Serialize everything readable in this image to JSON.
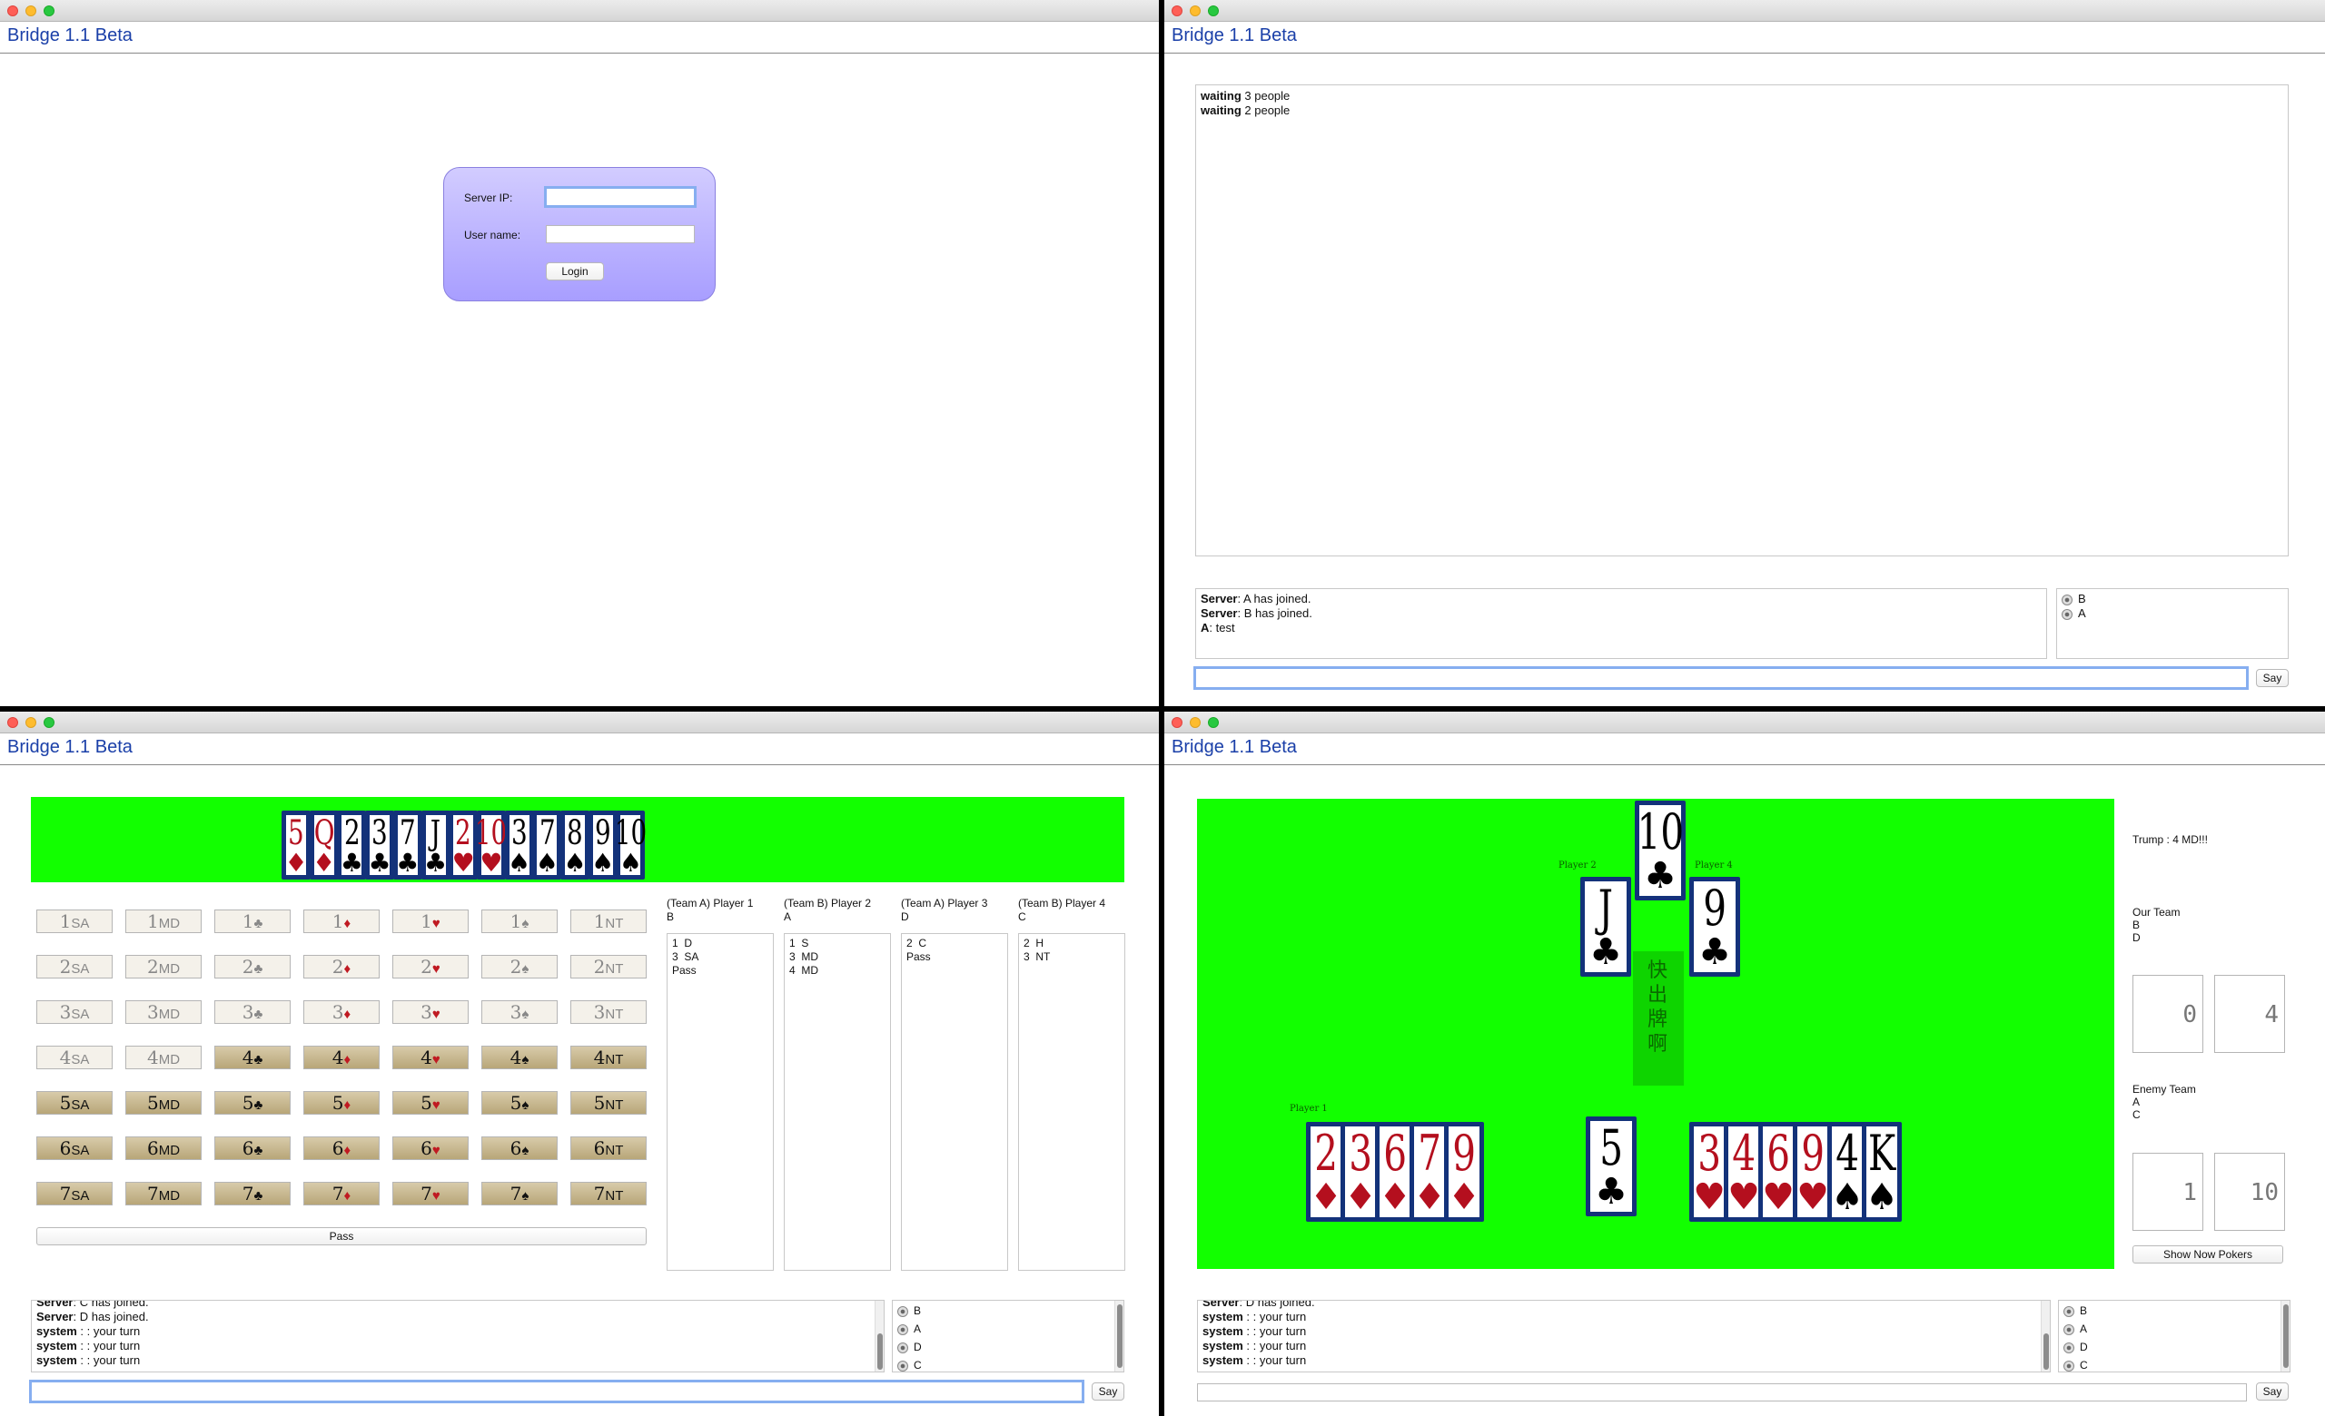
{
  "app_title": "Bridge 1.1 Beta",
  "login": {
    "server_ip_label": "Server IP:",
    "username_label": "User name:",
    "login_button": "Login"
  },
  "lobby": {
    "waiting_lines": [
      {
        "bold": "waiting",
        "text": " 3 people"
      },
      {
        "bold": "waiting",
        "text": " 2 people"
      }
    ],
    "chat": [
      {
        "who": "Server",
        "text": ": A has joined."
      },
      {
        "who": "Server",
        "text": ": B has joined."
      },
      {
        "who": "A",
        "text": ": test"
      }
    ],
    "players": [
      "B",
      "A"
    ],
    "say_button": "Say"
  },
  "bidding": {
    "hand": [
      {
        "rank": "5",
        "suit": "♦",
        "color": "red"
      },
      {
        "rank": "Q",
        "suit": "♦",
        "color": "red"
      },
      {
        "rank": "2",
        "suit": "♣",
        "color": "black"
      },
      {
        "rank": "3",
        "suit": "♣",
        "color": "black"
      },
      {
        "rank": "7",
        "suit": "♣",
        "color": "black"
      },
      {
        "rank": "J",
        "suit": "♣",
        "color": "black"
      },
      {
        "rank": "2",
        "suit": "♥",
        "color": "red"
      },
      {
        "rank": "10",
        "suit": "♥",
        "color": "red"
      },
      {
        "rank": "3",
        "suit": "♠",
        "color": "black"
      },
      {
        "rank": "7",
        "suit": "♠",
        "color": "black"
      },
      {
        "rank": "8",
        "suit": "♠",
        "color": "black"
      },
      {
        "rank": "9",
        "suit": "♠",
        "color": "black"
      },
      {
        "rank": "10",
        "suit": "♠",
        "color": "black"
      }
    ],
    "bid_suits": [
      "SA",
      "MD",
      "♣",
      "♦",
      "♥",
      "♠",
      "NT"
    ],
    "bid_levels": [
      "1",
      "2",
      "3",
      "4",
      "5",
      "6",
      "7"
    ],
    "pass_button": "Pass",
    "columns": [
      {
        "header1": "(Team A) Player 1",
        "header2": "B",
        "bids": [
          "1  D",
          "3  SA",
          "Pass"
        ]
      },
      {
        "header1": "(Team B) Player 2",
        "header2": "A",
        "bids": [
          "1  S",
          "3  MD",
          "4  MD"
        ]
      },
      {
        "header1": "(Team A) Player 3",
        "header2": "D",
        "bids": [
          "2  C",
          "Pass"
        ]
      },
      {
        "header1": "(Team B) Player 4",
        "header2": "C",
        "bids": [
          "2  H",
          "3  NT"
        ]
      }
    ],
    "chat": [
      {
        "who": "Server",
        "text": ": C has joined."
      },
      {
        "who": "Server",
        "text": ": D has joined."
      },
      {
        "who": "system",
        "text": " : : your turn"
      },
      {
        "who": "system",
        "text": " : : your turn"
      },
      {
        "who": "system",
        "text": " : : your turn"
      }
    ],
    "players": [
      "B",
      "A",
      "D",
      "C"
    ],
    "say_button": "Say"
  },
  "play": {
    "player2_label": "Player 2",
    "player4_label": "Player 4",
    "player1_label": "Player 1",
    "center_text": "快出牌啊",
    "table_cards": [
      {
        "rank": "10",
        "suit": "♣",
        "color": "black"
      },
      {
        "rank": "J",
        "suit": "♣",
        "color": "black"
      },
      {
        "rank": "9",
        "suit": "♣",
        "color": "black"
      },
      {
        "rank": "5",
        "suit": "♣",
        "color": "black"
      }
    ],
    "hand": [
      {
        "rank": "2",
        "suit": "♦",
        "color": "red"
      },
      {
        "rank": "3",
        "suit": "♦",
        "color": "red"
      },
      {
        "rank": "6",
        "suit": "♦",
        "color": "red"
      },
      {
        "rank": "7",
        "suit": "♦",
        "color": "red"
      },
      {
        "rank": "9",
        "suit": "♦",
        "color": "red"
      },
      {
        "rank": "3",
        "suit": "♥",
        "color": "red"
      },
      {
        "rank": "4",
        "suit": "♥",
        "color": "red"
      },
      {
        "rank": "6",
        "suit": "♥",
        "color": "red"
      },
      {
        "rank": "9",
        "suit": "♥",
        "color": "red"
      },
      {
        "rank": "4",
        "suit": "♠",
        "color": "black"
      },
      {
        "rank": "K",
        "suit": "♠",
        "color": "black"
      }
    ],
    "trump": "Trump : 4 MD!!!",
    "our_team_label": "Our Team",
    "our_team_members": [
      "B",
      "D"
    ],
    "our_scores": [
      "0",
      "4"
    ],
    "enemy_team_label": "Enemy Team",
    "enemy_team_members": [
      "A",
      "C"
    ],
    "enemy_scores": [
      "1",
      "10"
    ],
    "show_button": "Show Now Pokers",
    "chat": [
      {
        "who": "Server",
        "text": ": D has joined."
      },
      {
        "who": "system",
        "text": " : : your turn"
      },
      {
        "who": "system",
        "text": " : : your turn"
      },
      {
        "who": "system",
        "text": " : : your turn"
      },
      {
        "who": "system",
        "text": " : : your turn"
      }
    ],
    "players": [
      "B",
      "A",
      "D",
      "C"
    ],
    "say_button": "Say"
  },
  "colors": {
    "felt": "#12ff00",
    "card_border": "#13327a",
    "title_blue": "#1a3fa8",
    "login_panel": "#b9b0ff"
  }
}
